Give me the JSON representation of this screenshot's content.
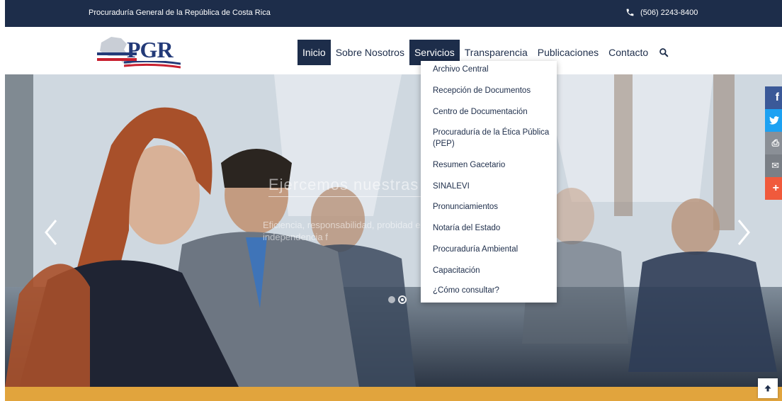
{
  "topbar": {
    "org_name": "Procuraduría General de la República de Costa Rica",
    "phone": "(506) 2243-8400",
    "phone_icon": "phone-icon"
  },
  "logo": {
    "text": "PGR"
  },
  "nav": {
    "items": [
      {
        "label": "Inicio",
        "state": "active"
      },
      {
        "label": "Sobre Nosotros",
        "state": "normal"
      },
      {
        "label": "Servicios",
        "state": "open"
      },
      {
        "label": "Transparencia",
        "state": "normal"
      },
      {
        "label": "Publicaciones",
        "state": "normal"
      },
      {
        "label": "Contacto",
        "state": "normal"
      }
    ],
    "search_icon": "search-icon"
  },
  "dropdown": {
    "items": [
      "Archivo Central",
      "Recepción de Documentos",
      "Centro de Documentación",
      "Procuraduría de la Ética Pública (PEP)",
      "Resumen Gacetario",
      "SINALEVI",
      "Pronunciamientos",
      "Notaría del Estado",
      "Procuraduría Ambiental",
      "Capacitación",
      "¿Cómo consultar?"
    ]
  },
  "hero": {
    "caption_title": "Ejercemos nuestras",
    "caption_sub": "Eficiencia, responsabilidad, probidad e independencia f",
    "slides_count": 2,
    "active_slide": 2
  },
  "social": [
    {
      "icon": "facebook-icon",
      "glyph": "f",
      "color": "#3b5998"
    },
    {
      "icon": "twitter-icon",
      "glyph": "🐦",
      "color": "#1da1f2"
    },
    {
      "icon": "print-icon",
      "glyph": "⎙",
      "color": "#8a8f96"
    },
    {
      "icon": "email-icon",
      "glyph": "✉",
      "color": "#7a7f86"
    },
    {
      "icon": "share-plus-icon",
      "glyph": "+",
      "color": "#f05a3c"
    }
  ],
  "colors": {
    "navy": "#1d2d4a",
    "accent_orange": "#e1a43d"
  }
}
